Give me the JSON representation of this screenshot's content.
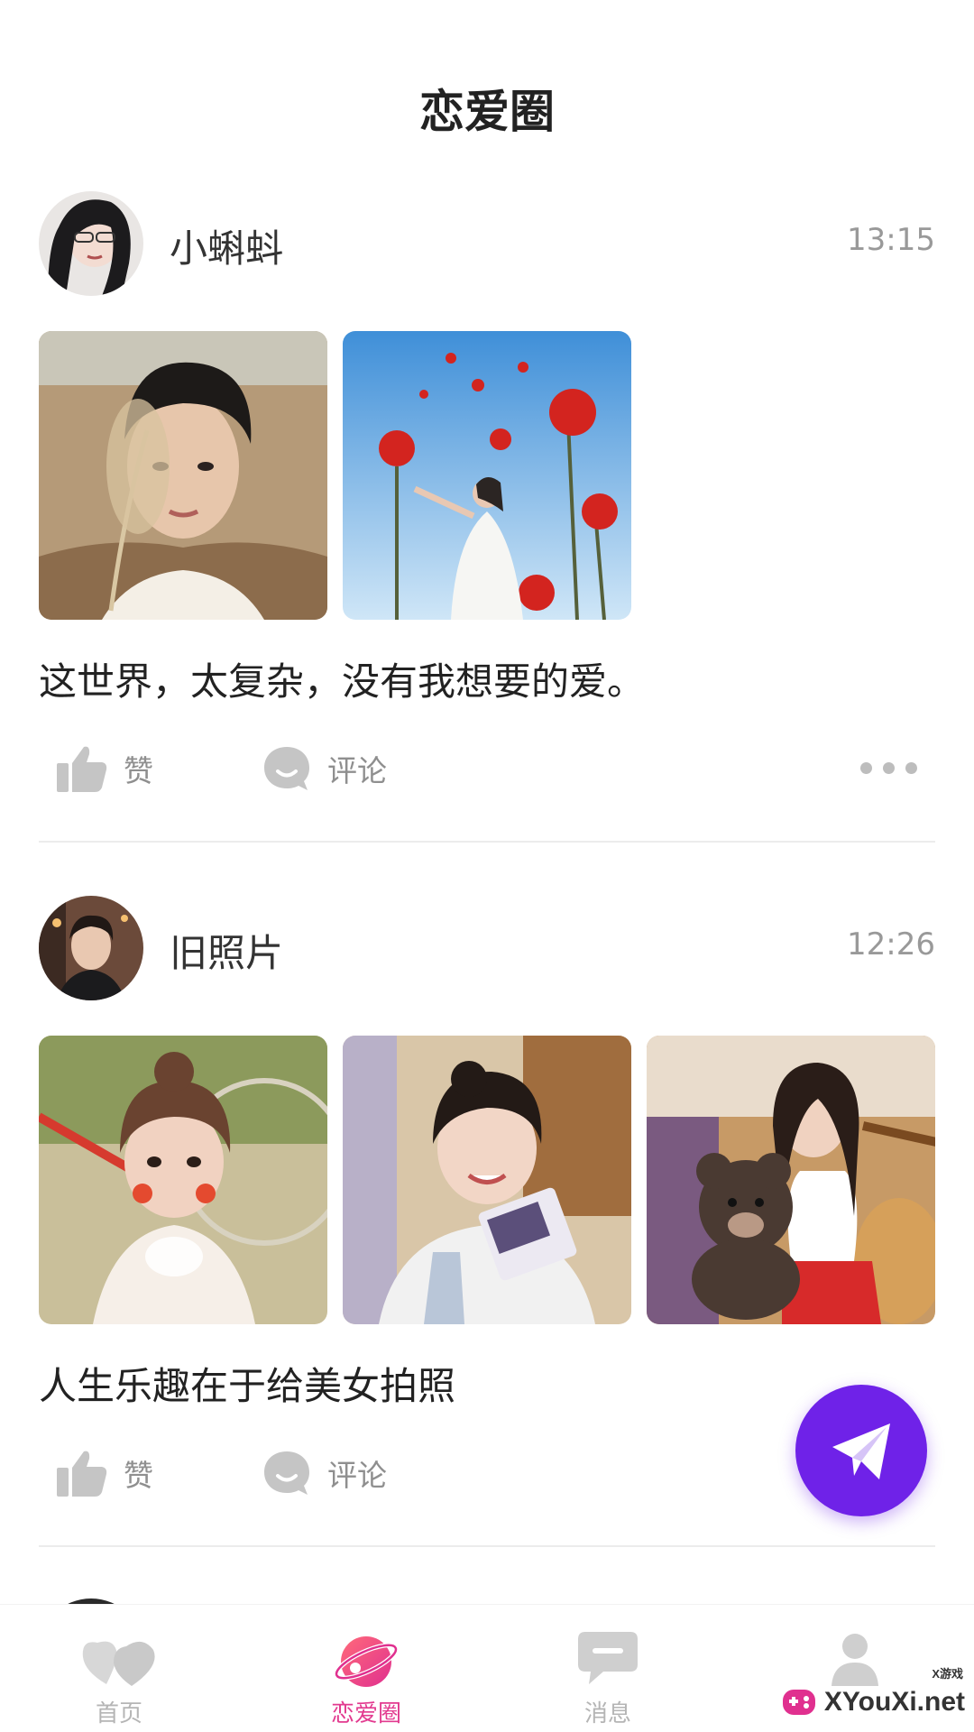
{
  "header": {
    "title": "恋爱圈"
  },
  "posts": [
    {
      "username": "小蝌蚪",
      "time": "13:15",
      "text": "这世界，太复杂，没有我想要的爱。",
      "images": [
        "man-with-reed-photo",
        "girl-with-poppies-photo"
      ],
      "actions": {
        "like": "赞",
        "comment": "评论"
      }
    },
    {
      "username": "旧照片",
      "time": "12:26",
      "text": "人生乐趣在于给美女拍照",
      "images": [
        "girl-with-bicycle-photo",
        "girl-with-camera-photo",
        "girl-with-teddy-bear-photo"
      ],
      "actions": {
        "like": "赞",
        "comment": "评论"
      }
    }
  ],
  "fab": {
    "icon": "paper-plane-icon",
    "color": "#6f22e8"
  },
  "tabbar": {
    "items": [
      {
        "label": "首页",
        "icon": "hearts-icon",
        "active": false
      },
      {
        "label": "恋爱圈",
        "icon": "planet-icon",
        "active": true
      },
      {
        "label": "消息",
        "icon": "chat-bubble-icon",
        "active": false
      },
      {
        "label": "",
        "icon": "profile-icon",
        "active": false
      }
    ],
    "active_color": "#e23a8f",
    "inactive_color": "#b5b5b5"
  },
  "watermark": {
    "text": "XYouXi.net",
    "small": "X游戏"
  }
}
